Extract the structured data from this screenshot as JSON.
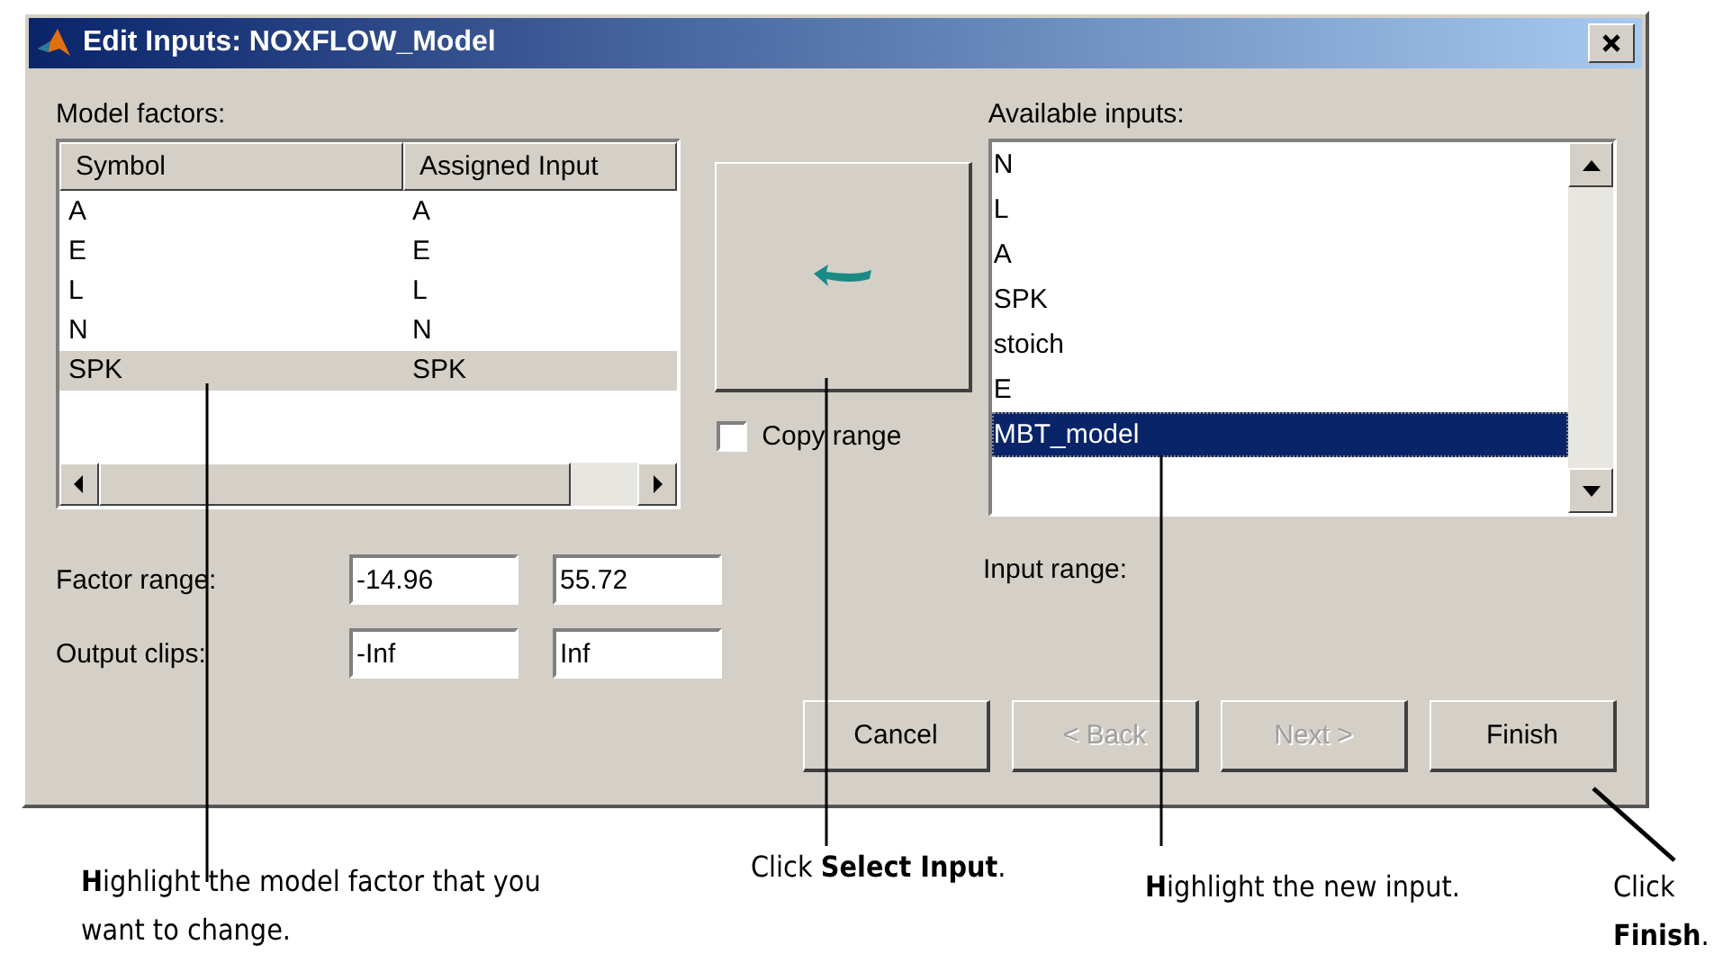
{
  "window": {
    "title": "Edit Inputs: NOXFLOW_Model"
  },
  "model_factors": {
    "label": "Model factors:",
    "columns": [
      "Symbol",
      "Assigned Input"
    ],
    "rows": [
      {
        "symbol": "A",
        "assigned_input": "A",
        "selected": false
      },
      {
        "symbol": "E",
        "assigned_input": "E",
        "selected": false
      },
      {
        "symbol": "L",
        "assigned_input": "L",
        "selected": false
      },
      {
        "symbol": "N",
        "assigned_input": "N",
        "selected": false
      },
      {
        "symbol": "SPK",
        "assigned_input": "SPK",
        "selected": true
      }
    ]
  },
  "copy_range": {
    "label": "Copy range",
    "checked": false
  },
  "available_inputs": {
    "label": "Available inputs:",
    "items": [
      {
        "label": "N",
        "selected": false
      },
      {
        "label": "L",
        "selected": false
      },
      {
        "label": "A",
        "selected": false
      },
      {
        "label": "SPK",
        "selected": false
      },
      {
        "label": "stoich",
        "selected": false
      },
      {
        "label": "E",
        "selected": false
      },
      {
        "label": "MBT_model",
        "selected": true
      }
    ]
  },
  "factor_range": {
    "label": "Factor range:",
    "min": "-14.96",
    "max": "55.72"
  },
  "output_clips": {
    "label": "Output clips:",
    "min": "-Inf",
    "max": "Inf"
  },
  "input_range": {
    "label": "Input range:"
  },
  "buttons": [
    {
      "label": "Cancel",
      "disabled": false
    },
    {
      "label": "< Back",
      "disabled": true
    },
    {
      "label": "Next >",
      "disabled": true
    },
    {
      "label": "Finish",
      "disabled": false
    }
  ],
  "callouts": [
    {
      "text": "**H**ighlight the model factor that you want to change."
    },
    {
      "text": "Click **Select Input**."
    },
    {
      "text": "**H**ighlight the new input."
    },
    {
      "text": "Click **Finish**."
    }
  ]
}
